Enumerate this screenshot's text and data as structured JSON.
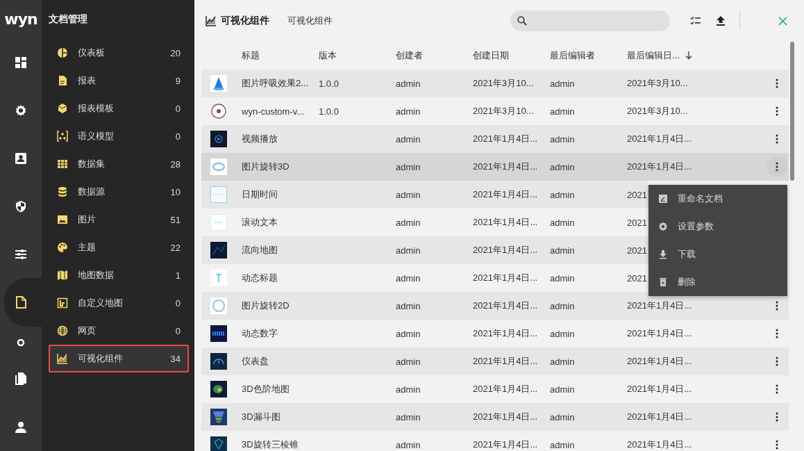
{
  "rail": {
    "logo": "wyn",
    "items": [
      {
        "selected": false
      },
      {
        "selected": false
      },
      {
        "selected": false
      },
      {
        "selected": false
      },
      {
        "selected": false
      },
      {
        "selected": true
      },
      {
        "selected": false
      },
      {
        "selected": false
      },
      {
        "selected": false
      }
    ]
  },
  "nav": {
    "title": "文档管理",
    "items": [
      {
        "label": "仪表板",
        "count": "20",
        "selected": false
      },
      {
        "label": "报表",
        "count": "9",
        "selected": false
      },
      {
        "label": "报表模板",
        "count": "0",
        "selected": false
      },
      {
        "label": "语义模型",
        "count": "0",
        "selected": false
      },
      {
        "label": "数据集",
        "count": "28",
        "selected": false
      },
      {
        "label": "数据源",
        "count": "10",
        "selected": false
      },
      {
        "label": "图片",
        "count": "51",
        "selected": false
      },
      {
        "label": "主题",
        "count": "22",
        "selected": false
      },
      {
        "label": "地图数据",
        "count": "1",
        "selected": false
      },
      {
        "label": "自定义地图",
        "count": "0",
        "selected": false
      },
      {
        "label": "网页",
        "count": "0",
        "selected": false
      },
      {
        "label": "可视化组件",
        "count": "34",
        "selected": true
      }
    ]
  },
  "header": {
    "title": "可视化组件",
    "subtitle": "可视化组件"
  },
  "table": {
    "columns": [
      "标题",
      "版本",
      "创建者",
      "创建日期",
      "最后编辑者",
      "最后编辑日..."
    ],
    "rows": [
      {
        "title": "图片呼吸效果2...",
        "version": "1.0.0",
        "creator": "admin",
        "created": "2021年3月10...",
        "editor": "admin",
        "edited": "2021年3月10...",
        "hovered": false,
        "more": true
      },
      {
        "title": "wyn-custom-v...",
        "version": "1.0.0",
        "creator": "admin",
        "created": "2021年3月10...",
        "editor": "admin",
        "edited": "2021年3月10...",
        "hovered": false,
        "more": true
      },
      {
        "title": "视频播放",
        "creator": "admin",
        "created": "2021年1月4日...",
        "editor": "admin",
        "edited": "2021年1月4日...",
        "hovered": false,
        "more": true
      },
      {
        "title": "图片旋转3D",
        "creator": "admin",
        "created": "2021年1月4日...",
        "editor": "admin",
        "edited": "2021年1月4日...",
        "hovered": true,
        "more": true
      },
      {
        "title": "日期时间",
        "creator": "admin",
        "created": "2021年1月4日...",
        "editor": "admin",
        "edited": "2021",
        "hovered": false,
        "more": false
      },
      {
        "title": "滚动文本",
        "creator": "admin",
        "created": "2021年1月4日...",
        "editor": "admin",
        "edited": "2021",
        "hovered": false,
        "more": false
      },
      {
        "title": "流向地图",
        "creator": "admin",
        "created": "2021年1月4日...",
        "editor": "admin",
        "edited": "2021",
        "hovered": false,
        "more": false
      },
      {
        "title": "动态标题",
        "creator": "admin",
        "created": "2021年1月4日...",
        "editor": "admin",
        "edited": "2021",
        "hovered": false,
        "more": false
      },
      {
        "title": "图片旋转2D",
        "creator": "admin",
        "created": "2021年1月4日...",
        "editor": "admin",
        "edited": "2021年1月4日...",
        "hovered": false,
        "more": true
      },
      {
        "title": "动态数字",
        "creator": "admin",
        "created": "2021年1月4日...",
        "editor": "admin",
        "edited": "2021年1月4日...",
        "hovered": false,
        "more": true
      },
      {
        "title": "仪表盘",
        "creator": "admin",
        "created": "2021年1月4日...",
        "editor": "admin",
        "edited": "2021年1月4日...",
        "hovered": false,
        "more": true
      },
      {
        "title": "3D色阶地图",
        "creator": "admin",
        "created": "2021年1月4日...",
        "editor": "admin",
        "edited": "2021年1月4日...",
        "hovered": false,
        "more": true
      },
      {
        "title": "3D漏斗图",
        "creator": "admin",
        "created": "2021年1月4日...",
        "editor": "admin",
        "edited": "2021年1月4日...",
        "hovered": false,
        "more": true
      },
      {
        "title": "3D旋转三棱锥",
        "creator": "admin",
        "created": "2021年1月4日...",
        "editor": "admin",
        "edited": "2021年1月4日...",
        "hovered": false,
        "more": true
      }
    ]
  },
  "context_menu": {
    "items": [
      "重命名文档",
      "设置参数",
      "下载",
      "删除"
    ]
  }
}
